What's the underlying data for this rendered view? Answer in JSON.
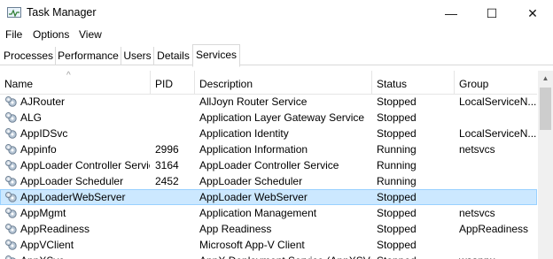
{
  "window": {
    "title": "Task Manager",
    "minimize_glyph": "—",
    "maximize_glyph": "☐",
    "close_glyph": "✕"
  },
  "menu": [
    "File",
    "Options",
    "View"
  ],
  "tabs": [
    "Processes",
    "Performance",
    "Users",
    "Details",
    "Services"
  ],
  "active_tab": "Services",
  "columns": {
    "name": "Name",
    "pid": "PID",
    "description": "Description",
    "status": "Status",
    "group": "Group",
    "sort_glyph": "^"
  },
  "rows": [
    {
      "name": "AJRouter",
      "pid": "",
      "description": "AllJoyn Router Service",
      "status": "Stopped",
      "group": "LocalServiceN..."
    },
    {
      "name": "ALG",
      "pid": "",
      "description": "Application Layer Gateway Service",
      "status": "Stopped",
      "group": ""
    },
    {
      "name": "AppIDSvc",
      "pid": "",
      "description": "Application Identity",
      "status": "Stopped",
      "group": "LocalServiceN..."
    },
    {
      "name": "Appinfo",
      "pid": "2996",
      "description": "Application Information",
      "status": "Running",
      "group": "netsvcs"
    },
    {
      "name": "AppLoader Controller Service",
      "pid": "3164",
      "description": "AppLoader Controller Service",
      "status": "Running",
      "group": ""
    },
    {
      "name": "AppLoader Scheduler",
      "pid": "2452",
      "description": "AppLoader Scheduler",
      "status": "Running",
      "group": ""
    },
    {
      "name": "AppLoaderWebServer",
      "pid": "",
      "description": "AppLoader WebServer",
      "status": "Stopped",
      "group": ""
    },
    {
      "name": "AppMgmt",
      "pid": "",
      "description": "Application Management",
      "status": "Stopped",
      "group": "netsvcs"
    },
    {
      "name": "AppReadiness",
      "pid": "",
      "description": "App Readiness",
      "status": "Stopped",
      "group": "AppReadiness"
    },
    {
      "name": "AppVClient",
      "pid": "",
      "description": "Microsoft App-V Client",
      "status": "Stopped",
      "group": ""
    },
    {
      "name": "AppXSvc",
      "pid": "",
      "description": "AppX Deployment Service (AppXSVC)",
      "status": "Stopped",
      "group": "wsappx"
    }
  ],
  "selected_row": "AppLoaderWebServer",
  "colors": {
    "selection": "#cce8ff",
    "selection_border": "#99d1ff"
  },
  "icons": {
    "app": "task-manager-icon",
    "service": "gear-icon"
  }
}
